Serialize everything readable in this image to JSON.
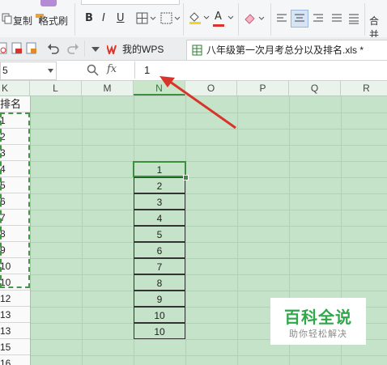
{
  "ribbon": {
    "copy_label": "复制",
    "format_painter_label": "格式刷",
    "bold": "B",
    "italic": "I",
    "underline": "U",
    "font_color_letter": "A",
    "merge_label": "合并"
  },
  "tabs": [
    {
      "label": "我的WPS"
    },
    {
      "label": "八年级第一次月考总分以及排名.xls *"
    }
  ],
  "formula_bar": {
    "name_box": "5",
    "fx": "fx",
    "value": "1"
  },
  "columns": [
    "K",
    "L",
    "M",
    "N",
    "O",
    "P",
    "Q",
    "R"
  ],
  "row_headers": [
    "排名",
    "1",
    "2",
    "3",
    "4",
    "5",
    "6",
    "7",
    "8",
    "9",
    "10",
    "12",
    "13",
    "13",
    "15",
    "16"
  ],
  "n_values": [
    "1",
    "2",
    "3",
    "4",
    "5",
    "6",
    "7",
    "8",
    "9",
    "10",
    "10"
  ],
  "watermark": {
    "title": "百科全说",
    "subtitle": "助你轻松解决"
  },
  "colors": {
    "sheet_bg": "#c5e3c8",
    "accent_red": "#d9342b",
    "selection": "#3c8f3f"
  }
}
